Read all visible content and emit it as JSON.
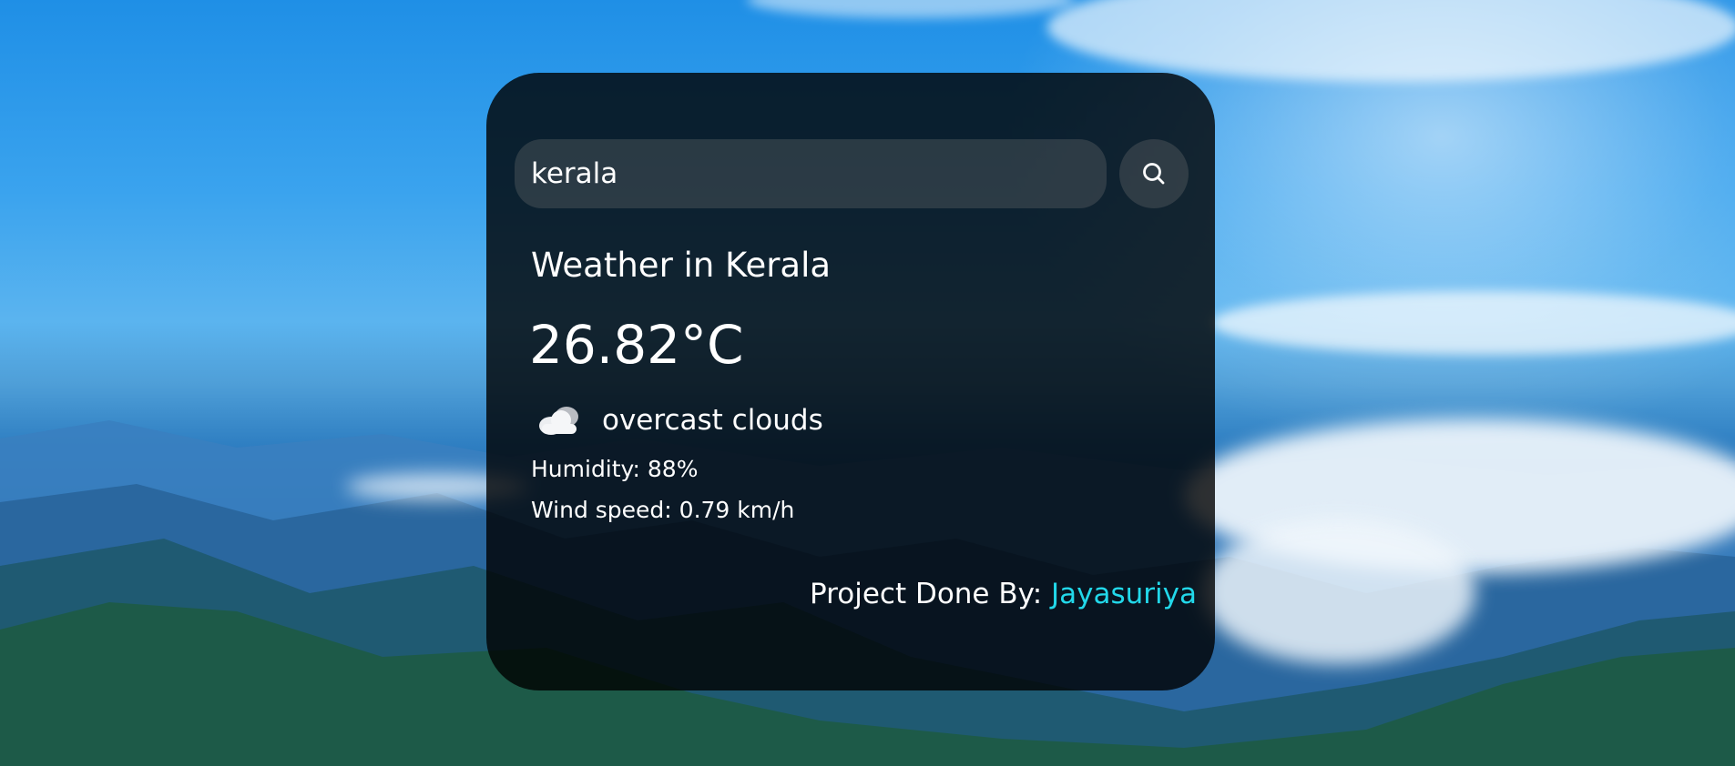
{
  "search": {
    "value": "kerala",
    "button_icon": "search-icon"
  },
  "weather": {
    "title": "Weather in Kerala",
    "temperature": "26.82°C",
    "icon": "cloud-icon",
    "description": "overcast clouds",
    "humidity": "Humidity: 88%",
    "wind": "Wind speed: 0.79 km/h"
  },
  "credit": {
    "label": "Project Done By: ",
    "name": "Jayasuriya",
    "name_color": "#22d8ea"
  },
  "colors": {
    "card_bg": "rgba(0,0,0,0.80)",
    "text": "#ffffff",
    "accent": "#22d8ea"
  }
}
